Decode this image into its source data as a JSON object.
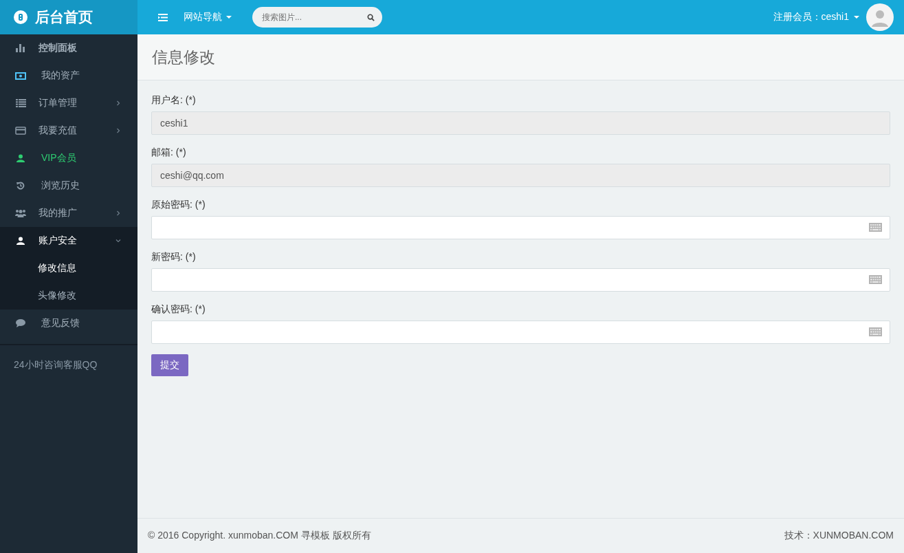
{
  "brand": {
    "title": "后台首页"
  },
  "topbar": {
    "nav_menu": "网站导航",
    "search": {
      "placeholder": "搜索图片..."
    },
    "user_label": "注册会员：ceshi1"
  },
  "sidebar": {
    "items": [
      {
        "label": "控制面板",
        "kind": "header"
      },
      {
        "label": "我的资产",
        "kind": "link"
      },
      {
        "label": "订单管理",
        "kind": "group",
        "expanded": false
      },
      {
        "label": "我要充值",
        "kind": "group",
        "expanded": false
      },
      {
        "label": "VIP会员",
        "kind": "promo"
      },
      {
        "label": "浏览历史",
        "kind": "link"
      },
      {
        "label": "我的推广",
        "kind": "group",
        "expanded": false
      },
      {
        "label": "账户安全",
        "kind": "group",
        "expanded": true,
        "children": [
          {
            "label": "修改信息",
            "selected": true
          },
          {
            "label": "头像修改",
            "selected": false
          }
        ]
      },
      {
        "label": "意见反馈",
        "kind": "link"
      }
    ],
    "note": "24小时咨询客服QQ"
  },
  "page": {
    "title": "信息修改"
  },
  "form": {
    "fields": [
      {
        "label": "用户名: (*)",
        "kind": "text",
        "value": "ceshi1",
        "disabled": true
      },
      {
        "label": "邮箱: (*)",
        "kind": "text",
        "value": "ceshi@qq.com",
        "disabled": true
      },
      {
        "label": "原始密码: (*)",
        "kind": "password",
        "disabled": false
      },
      {
        "label": "新密码: (*)",
        "kind": "password",
        "disabled": false
      },
      {
        "label": "确认密码: (*)",
        "kind": "password",
        "disabled": false
      }
    ],
    "submit": "提交"
  },
  "footer": {
    "copyright": "© 2016 Copyright. xunmoban.COM 寻模板 版权所有",
    "credit": "技术：XUNMOBAN.COM"
  }
}
